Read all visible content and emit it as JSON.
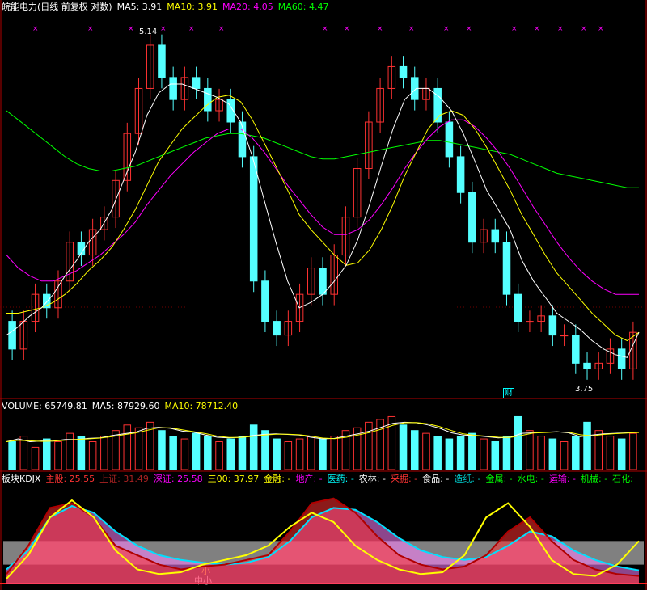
{
  "header": {
    "stock_label": "皖能电力(日线 前复权 对数)",
    "ma5": "MA5: 3.91",
    "ma10": "MA10: 3.91",
    "ma20": "MA20: 4.05",
    "ma60": "MA60: 4.47"
  },
  "price_annotations": {
    "high": "5.14",
    "low": "3.75",
    "marker_label": "财"
  },
  "volume_header": {
    "volume": "VOLUME: 65749.81",
    "ma5": "MA5: 87929.60",
    "ma10": "MA10: 78712.40"
  },
  "kdj_header": {
    "title": "板块KDJX",
    "items": [
      {
        "label": "主股:",
        "value": "25.55",
        "color": "#ff3333"
      },
      {
        "label": "上证:",
        "value": "31.49",
        "color": "#aa2222"
      },
      {
        "label": "深证:",
        "value": "25.58",
        "color": "#ff00ff"
      },
      {
        "label": "三00:",
        "value": "37.97",
        "color": "#ffff00"
      },
      {
        "label": "金融:",
        "value": "-",
        "color": "#ffff00"
      },
      {
        "label": "地产:",
        "value": "-",
        "color": "#ff00ff"
      },
      {
        "label": "医药:",
        "value": "-",
        "color": "#00ffff"
      },
      {
        "label": "农林:",
        "value": "-",
        "color": "#ffffff"
      },
      {
        "label": "采掘:",
        "value": "-",
        "color": "#ff3333"
      },
      {
        "label": "食品:",
        "value": "-",
        "color": "#ffffff"
      },
      {
        "label": "造纸:",
        "value": "-",
        "color": "#00cccc"
      },
      {
        "label": "金属:",
        "value": "-",
        "color": "#00ff00"
      },
      {
        "label": "水电:",
        "value": "-",
        "color": "#00ff00"
      },
      {
        "label": "运输:",
        "value": "-",
        "color": "#ff00ff"
      },
      {
        "label": "机械:",
        "value": "-",
        "color": "#00ff00"
      },
      {
        "label": "石化:",
        "value": "",
        "color": "#00ff00"
      }
    ],
    "overlay_labels": [
      "大",
      "小",
      "中小",
      "背景"
    ]
  },
  "colors": {
    "up": "#ff3232",
    "down": "#54ffff",
    "ma5": "#ffffff",
    "ma10": "#ffff00",
    "ma20": "#ff00ff",
    "ma60": "#00ff00",
    "border": "#b00000"
  },
  "chart_data": {
    "type": "candlestick",
    "price_scale": "log",
    "ylim": [
      3.7,
      5.2
    ],
    "points": [
      {
        "o": 3.95,
        "c": 3.85
      },
      {
        "o": 3.85,
        "c": 3.95
      },
      {
        "o": 3.95,
        "c": 4.05
      },
      {
        "o": 4.05,
        "c": 4.0
      },
      {
        "o": 4.0,
        "c": 4.1
      },
      {
        "o": 4.1,
        "c": 4.25
      },
      {
        "o": 4.25,
        "c": 4.2
      },
      {
        "o": 4.2,
        "c": 4.3
      },
      {
        "o": 4.3,
        "c": 4.35
      },
      {
        "o": 4.35,
        "c": 4.5
      },
      {
        "o": 4.5,
        "c": 4.7
      },
      {
        "o": 4.7,
        "c": 4.9
      },
      {
        "o": 4.9,
        "c": 5.1
      },
      {
        "o": 5.1,
        "c": 4.95
      },
      {
        "o": 4.95,
        "c": 4.85
      },
      {
        "o": 4.85,
        "c": 4.95
      },
      {
        "o": 4.95,
        "c": 4.9
      },
      {
        "o": 4.9,
        "c": 4.8
      },
      {
        "o": 4.8,
        "c": 4.85
      },
      {
        "o": 4.85,
        "c": 4.75
      },
      {
        "o": 4.75,
        "c": 4.6
      },
      {
        "o": 4.6,
        "c": 4.1
      },
      {
        "o": 4.1,
        "c": 3.95
      },
      {
        "o": 3.95,
        "c": 3.9
      },
      {
        "o": 3.9,
        "c": 3.95
      },
      {
        "o": 3.95,
        "c": 4.05
      },
      {
        "o": 4.05,
        "c": 4.15
      },
      {
        "o": 4.15,
        "c": 4.05
      },
      {
        "o": 4.05,
        "c": 4.2
      },
      {
        "o": 4.2,
        "c": 4.35
      },
      {
        "o": 4.35,
        "c": 4.55
      },
      {
        "o": 4.55,
        "c": 4.75
      },
      {
        "o": 4.75,
        "c": 4.9
      },
      {
        "o": 4.9,
        "c": 5.0
      },
      {
        "o": 5.0,
        "c": 4.95
      },
      {
        "o": 4.95,
        "c": 4.85
      },
      {
        "o": 4.85,
        "c": 4.9
      },
      {
        "o": 4.9,
        "c": 4.75
      },
      {
        "o": 4.75,
        "c": 4.6
      },
      {
        "o": 4.6,
        "c": 4.45
      },
      {
        "o": 4.45,
        "c": 4.25
      },
      {
        "o": 4.25,
        "c": 4.3
      },
      {
        "o": 4.3,
        "c": 4.25
      },
      {
        "o": 4.25,
        "c": 4.05
      },
      {
        "o": 4.05,
        "c": 3.95
      },
      {
        "o": 3.95,
        "c": 3.95
      },
      {
        "o": 3.95,
        "c": 3.97
      },
      {
        "o": 3.97,
        "c": 3.9
      },
      {
        "o": 3.9,
        "c": 3.9
      },
      {
        "o": 3.9,
        "c": 3.8
      },
      {
        "o": 3.8,
        "c": 3.78
      },
      {
        "o": 3.78,
        "c": 3.8
      },
      {
        "o": 3.8,
        "c": 3.85
      },
      {
        "o": 3.85,
        "c": 3.78
      },
      {
        "o": 3.78,
        "c": 3.91
      }
    ],
    "ma5": [
      3.9,
      3.93,
      3.97,
      4.0,
      4.05,
      4.12,
      4.18,
      4.25,
      4.3,
      4.38,
      4.5,
      4.62,
      4.78,
      4.88,
      4.92,
      4.92,
      4.9,
      4.88,
      4.86,
      4.83,
      4.75,
      4.6,
      4.42,
      4.25,
      4.1,
      4.0,
      4.02,
      4.05,
      4.1,
      4.16,
      4.26,
      4.4,
      4.56,
      4.72,
      4.85,
      4.9,
      4.9,
      4.86,
      4.8,
      4.7,
      4.58,
      4.46,
      4.38,
      4.3,
      4.18,
      4.1,
      4.04,
      3.98,
      3.95,
      3.92,
      3.88,
      3.85,
      3.83,
      3.82,
      3.91
    ],
    "ma10": [
      3.98,
      3.98,
      3.99,
      4.0,
      4.02,
      4.05,
      4.09,
      4.14,
      4.18,
      4.23,
      4.3,
      4.38,
      4.48,
      4.58,
      4.65,
      4.72,
      4.77,
      4.82,
      4.86,
      4.87,
      4.84,
      4.76,
      4.66,
      4.56,
      4.46,
      4.36,
      4.3,
      4.25,
      4.2,
      4.16,
      4.17,
      4.22,
      4.3,
      4.4,
      4.52,
      4.62,
      4.72,
      4.78,
      4.8,
      4.78,
      4.72,
      4.64,
      4.55,
      4.46,
      4.36,
      4.28,
      4.2,
      4.13,
      4.08,
      4.03,
      3.98,
      3.94,
      3.9,
      3.88,
      3.91
    ],
    "ma20": [
      4.2,
      4.15,
      4.12,
      4.1,
      4.1,
      4.12,
      4.14,
      4.17,
      4.2,
      4.24,
      4.28,
      4.33,
      4.4,
      4.46,
      4.52,
      4.57,
      4.62,
      4.66,
      4.7,
      4.72,
      4.72,
      4.68,
      4.62,
      4.55,
      4.48,
      4.42,
      4.36,
      4.31,
      4.28,
      4.28,
      4.3,
      4.34,
      4.4,
      4.47,
      4.55,
      4.62,
      4.68,
      4.73,
      4.76,
      4.76,
      4.73,
      4.68,
      4.62,
      4.55,
      4.47,
      4.39,
      4.32,
      4.25,
      4.19,
      4.14,
      4.1,
      4.07,
      4.05,
      4.05,
      4.05
    ],
    "ma60": [
      4.8,
      4.76,
      4.72,
      4.68,
      4.64,
      4.6,
      4.57,
      4.55,
      4.54,
      4.54,
      4.55,
      4.56,
      4.58,
      4.6,
      4.62,
      4.64,
      4.66,
      4.68,
      4.69,
      4.7,
      4.7,
      4.69,
      4.68,
      4.66,
      4.64,
      4.62,
      4.6,
      4.59,
      4.59,
      4.6,
      4.61,
      4.62,
      4.63,
      4.64,
      4.65,
      4.66,
      4.67,
      4.67,
      4.66,
      4.65,
      4.64,
      4.63,
      4.62,
      4.61,
      4.59,
      4.57,
      4.55,
      4.53,
      4.52,
      4.51,
      4.5,
      4.49,
      4.48,
      4.47,
      4.47
    ],
    "volume": [
      0.5,
      0.6,
      0.4,
      0.55,
      0.5,
      0.65,
      0.6,
      0.5,
      0.6,
      0.7,
      0.8,
      0.75,
      0.85,
      0.7,
      0.6,
      0.55,
      0.65,
      0.6,
      0.5,
      0.55,
      0.6,
      0.8,
      0.7,
      0.55,
      0.5,
      0.55,
      0.6,
      0.55,
      0.6,
      0.7,
      0.75,
      0.85,
      0.9,
      0.95,
      0.8,
      0.7,
      0.65,
      0.6,
      0.55,
      0.6,
      0.65,
      0.55,
      0.5,
      0.6,
      0.95,
      0.7,
      0.6,
      0.55,
      0.5,
      0.6,
      0.85,
      0.7,
      0.6,
      0.55,
      0.65
    ],
    "kdj_main": [
      10,
      40,
      80,
      85,
      70,
      40,
      30,
      20,
      15,
      18,
      20,
      25,
      30,
      55,
      85,
      90,
      75,
      50,
      30,
      20,
      15,
      18,
      30,
      55,
      70,
      45,
      25,
      15,
      10,
      8
    ],
    "kdj_second": [
      15,
      35,
      70,
      82,
      75,
      55,
      40,
      30,
      25,
      22,
      20,
      22,
      28,
      45,
      70,
      80,
      78,
      65,
      48,
      35,
      28,
      25,
      28,
      40,
      55,
      50,
      35,
      25,
      18,
      14
    ],
    "kdj_yellow": [
      5,
      30,
      70,
      88,
      70,
      35,
      15,
      10,
      12,
      20,
      25,
      30,
      40,
      60,
      75,
      65,
      40,
      25,
      15,
      10,
      12,
      30,
      70,
      85,
      60,
      25,
      10,
      8,
      20,
      45
    ]
  }
}
